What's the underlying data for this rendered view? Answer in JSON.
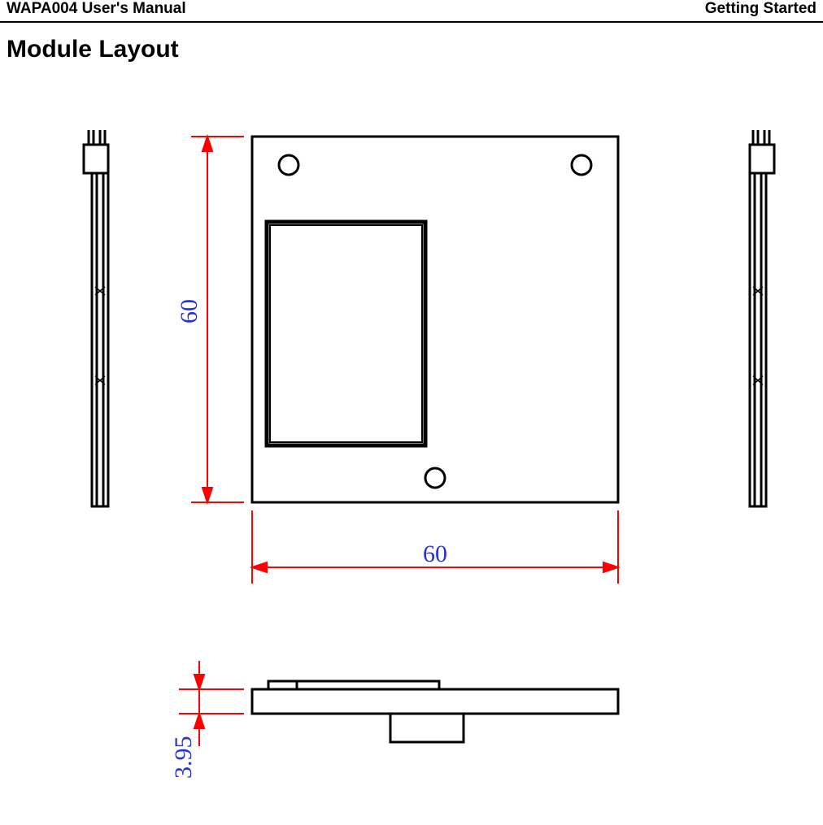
{
  "header": {
    "left": "WAPA004 User's Manual",
    "right": "Getting Started"
  },
  "title": "Module Layout",
  "dimensions": {
    "width_label": "60",
    "height_label": "60",
    "thickness_label": "3.95"
  }
}
